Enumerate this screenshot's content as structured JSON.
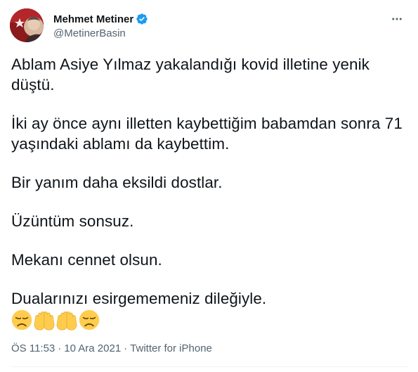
{
  "author": {
    "display_name": "Mehmet Metiner",
    "handle": "@MetinerBasin",
    "verified_icon": "verified-badge-icon",
    "verified_color": "#1d9bf0",
    "avatar_bg": "#8a1a1c"
  },
  "more_icon": "ellipsis-icon",
  "tweet": {
    "lines": [
      "Ablam Asiye Yılmaz yakalandığı kovid illetine yenik düştü.",
      "İki ay önce aynı illetten kaybettiğim babamdan sonra 71 yaşındaki ablamı da kaybettim.",
      "Bir yanım daha eksildi dostlar.",
      "Üzüntüm sonsuz.",
      "Mekanı cennet olsun.",
      "Dualarınızı esirgememeniz dileğiyle."
    ],
    "emojis": [
      "disappointed-face",
      "open-hands",
      "open-hands",
      "disappointed-face"
    ]
  },
  "meta": {
    "time": "ÖS 11:53",
    "separator": "·",
    "date": "10 Ara 2021",
    "source": "Twitter for iPhone"
  },
  "colors": {
    "text": "#0f1419",
    "secondary": "#536471",
    "emoji_face": "#ffcc4d",
    "emoji_feature": "#664500"
  }
}
